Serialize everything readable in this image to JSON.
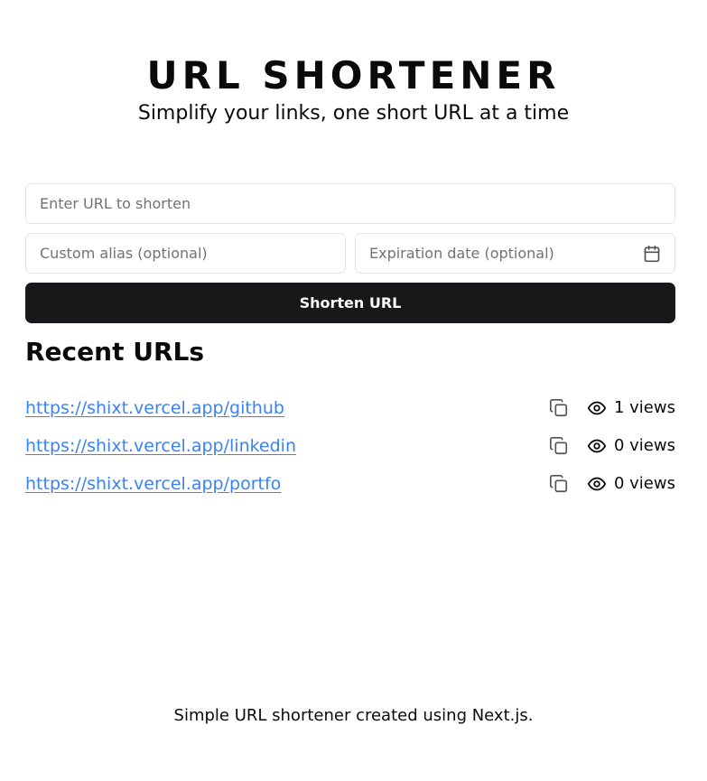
{
  "header": {
    "title": "URL SHORTENER",
    "subtitle": "Simplify your links, one short URL at a time"
  },
  "form": {
    "url_placeholder": "Enter URL to shorten",
    "alias_placeholder": "Custom alias (optional)",
    "expiration_placeholder": "Expiration date (optional)",
    "submit_label": "Shorten URL"
  },
  "recent": {
    "title": "Recent URLs",
    "items": [
      {
        "url": "https://shixt.vercel.app/github",
        "views": "1 views"
      },
      {
        "url": "https://shixt.vercel.app/linkedin",
        "views": "0 views"
      },
      {
        "url": "https://shixt.vercel.app/portfo",
        "views": "0 views"
      }
    ]
  },
  "footer": {
    "text": "Simple URL shortener created using Next.js."
  },
  "colors": {
    "accent": "#18181b",
    "link": "#3b82f6",
    "border": "#e4e4e7",
    "placeholder": "#71717a"
  },
  "icons": [
    "calendar-icon",
    "copy-icon",
    "eye-icon"
  ]
}
